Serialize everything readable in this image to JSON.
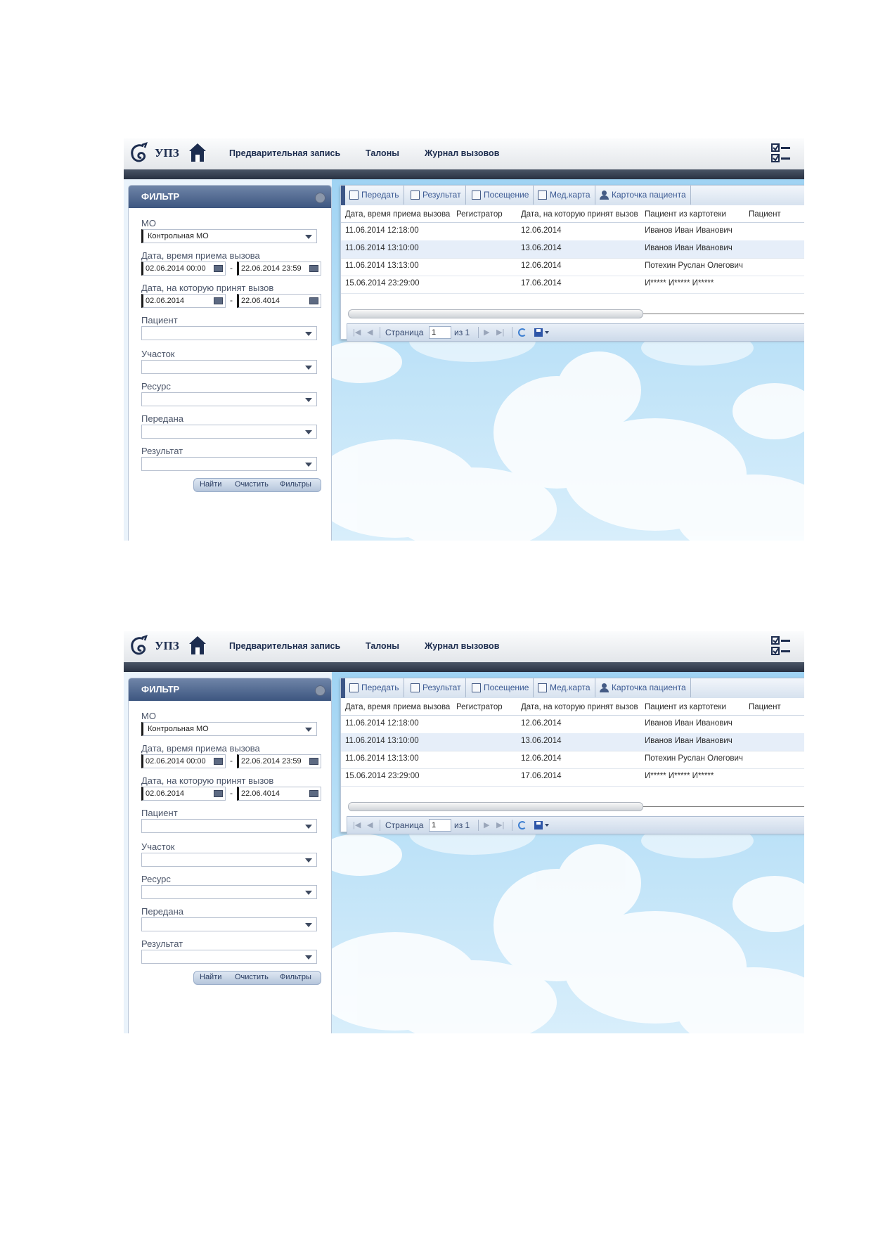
{
  "app": {
    "name": "УПЗ"
  },
  "nav": [
    "Предварительная запись",
    "Талоны",
    "Журнал вызовов"
  ],
  "filter": {
    "title": "ФИЛЬТР",
    "mo_label": "МО",
    "mo_value": "Контрольная МО",
    "call_time_label": "Дата, время приема вызова",
    "call_time_from": "02.06.2014 00:00",
    "call_time_to": "22.06.2014 23:59",
    "accept_date_label": "Дата, на которую принят вызов",
    "accept_date_from": "02.06.2014",
    "accept_date_to": "22.06.4014",
    "patient_label": "Пациент",
    "district_label": "Участок",
    "resource_label": "Ресурс",
    "transferred_label": "Передана",
    "result_label": "Результат",
    "dash": "-",
    "buttons": {
      "find": "Найти",
      "clear": "Очистить",
      "filters": "Фильтры"
    }
  },
  "toolbar": [
    "Передать",
    "Результат",
    "Посещение",
    "Мед.карта",
    "Карточка пациента"
  ],
  "grid": {
    "columns": [
      "Дата, время приема вызова",
      "Регистратор",
      "Дата, на которую принят вызов",
      "Пациент из картотеки",
      "Пациент"
    ],
    "rows": [
      [
        "11.06.2014 12:18:00",
        "",
        "12.06.2014",
        "Иванов Иван Иванович",
        ""
      ],
      [
        "11.06.2014 13:10:00",
        "",
        "13.06.2014",
        "Иванов Иван Иванович",
        ""
      ],
      [
        "11.06.2014 13:13:00",
        "",
        "12.06.2014",
        "Потехин Руслан Олегович",
        ""
      ],
      [
        "15.06.2014 23:29:00",
        "",
        "17.06.2014",
        "И***** И***** И*****",
        ""
      ]
    ]
  },
  "pager": {
    "page_label": "Страница",
    "page_value": "1",
    "of_label": "из 1"
  },
  "colors": {
    "header_blue": "#3d5680",
    "link_blue": "#3c5a93",
    "dark_band": "#283142"
  }
}
